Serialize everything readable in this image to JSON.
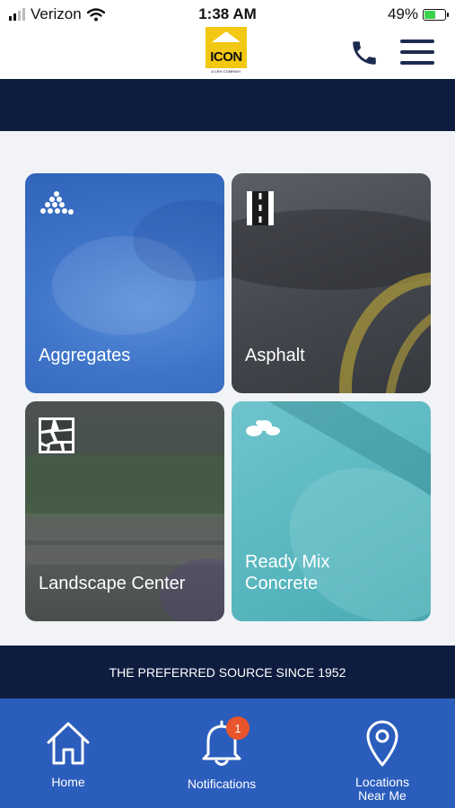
{
  "status_bar": {
    "carrier": "Verizon",
    "time": "1:38 AM",
    "battery": "49%"
  },
  "header": {
    "logo_text": "ICON",
    "logo_subtext": "A CRH COMPANY",
    "brand_color": "#f2c812",
    "phone_icon": "phone-icon",
    "menu_icon": "hamburger-menu-icon"
  },
  "tiles": [
    {
      "label": "Aggregates",
      "icon": "rock-pile-icon"
    },
    {
      "label": "Asphalt",
      "icon": "road-icon"
    },
    {
      "label": "Landscape Center",
      "icon": "stone-wall-icon"
    },
    {
      "label_line1": "Ready Mix",
      "label_line2": "Concrete",
      "icon": "concrete-icon"
    }
  ],
  "tagline": "THE PREFERRED SOURCE SINCE 1952",
  "tab_bar": {
    "home": {
      "label": "Home",
      "icon": "home-icon"
    },
    "notifications": {
      "label": "Notifications",
      "icon": "bell-icon",
      "badge": "1"
    },
    "locations": {
      "label_line1": "Locations",
      "label_line2": "Near Me",
      "icon": "map-pin-icon"
    }
  },
  "colors": {
    "nav_dark": "#0e1c3f",
    "tab_blue": "#2b5dbd",
    "badge": "#e8542b"
  }
}
